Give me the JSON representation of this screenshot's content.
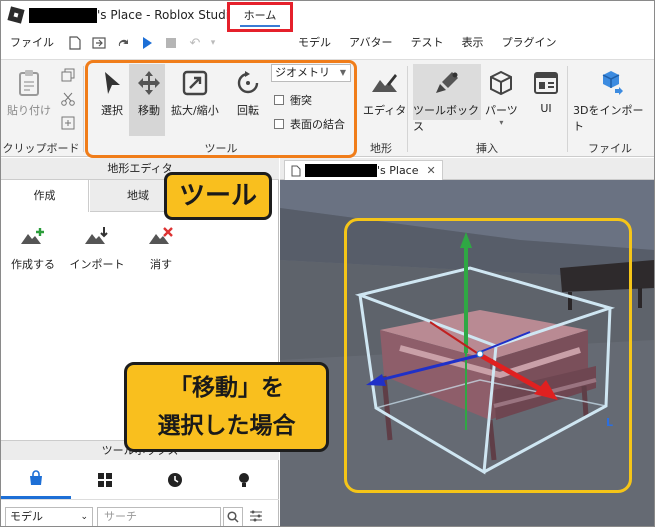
{
  "window": {
    "title_suffix": "'s Place - Roblox Studio"
  },
  "menu": {
    "items": [
      "ファイル",
      "ホーム",
      "モデル",
      "アバター",
      "テスト",
      "表示",
      "プラグイン"
    ]
  },
  "ribbon": {
    "clipboard": {
      "paste_label": "貼り付け",
      "group_label": "クリップボード"
    },
    "tools": {
      "select_label": "選択",
      "move_label": "移動",
      "scale_label": "拡大/縮小",
      "rotate_label": "回転",
      "dropdown_value": "ジオメトリ",
      "collision_label": "衝突",
      "surface_join_label": "表面の結合",
      "group_label": "ツール"
    },
    "terrain": {
      "editor_label": "エディタ",
      "group_label": "地形"
    },
    "insert": {
      "toolbox_label": "ツールボックス",
      "parts_label": "パーツ",
      "ui_label": "UI",
      "group_label": "挿入"
    },
    "file": {
      "import3d_label": "3Dをインポート",
      "group_label": "ファイル"
    }
  },
  "terrain_editor": {
    "header": "地形エディタ",
    "tabs": [
      "作成",
      "地域"
    ],
    "actions": [
      "作成する",
      "インポート",
      "消す"
    ]
  },
  "toolbox": {
    "header": "ツールボックス",
    "category_value": "モデル",
    "search_placeholder": "サーチ"
  },
  "document": {
    "tab_suffix": "'s Place"
  },
  "callouts": {
    "tool": "ツール",
    "move_line1": "「移動」を",
    "move_line2": "選択した場合"
  },
  "colors": {
    "tool_box_outline": "#f07d1a",
    "home_tab_outline": "#e5202b",
    "callout_fill": "#f9bf1e",
    "selection_box": "#f5c518",
    "active_tab": "#1d6fd6"
  }
}
